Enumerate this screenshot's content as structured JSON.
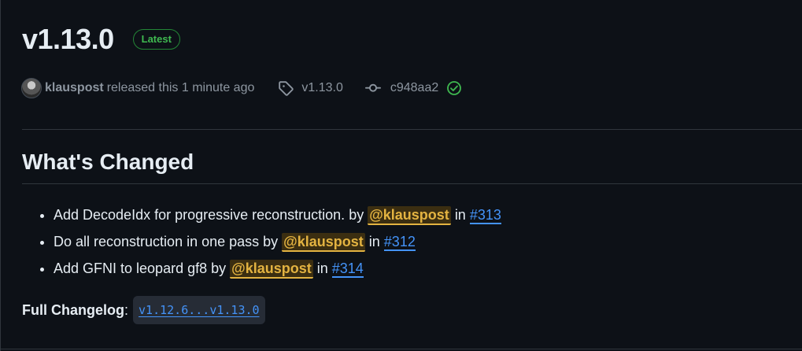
{
  "release": {
    "title": "v1.13.0",
    "badge": "Latest",
    "author": "klauspost",
    "released_text": "released this 1 minute ago",
    "tag": "v1.13.0",
    "commit": "c948aa2"
  },
  "changes": {
    "heading": "What's Changed",
    "items": [
      {
        "text": "Add DecodeIdx for progressive reconstruction. by",
        "mention": "@klauspost",
        "in": "in",
        "pr": "#313"
      },
      {
        "text": "Do all reconstruction in one pass by",
        "mention": "@klauspost",
        "in": "in",
        "pr": "#312"
      },
      {
        "text": "Add GFNI to leopard gf8 by",
        "mention": "@klauspost",
        "in": "in",
        "pr": "#314"
      }
    ]
  },
  "changelog": {
    "label": "Full Changelog",
    "colon": ":",
    "link": "v1.12.6...v1.13.0"
  },
  "icons": {
    "tag": "tag-icon",
    "commit": "git-commit-icon",
    "verified": "verified-check-icon"
  },
  "colors": {
    "background": "#0d1117",
    "badge_green": "#3fb950",
    "mention_yellow": "#e3b341",
    "link_blue": "#4493f8"
  }
}
